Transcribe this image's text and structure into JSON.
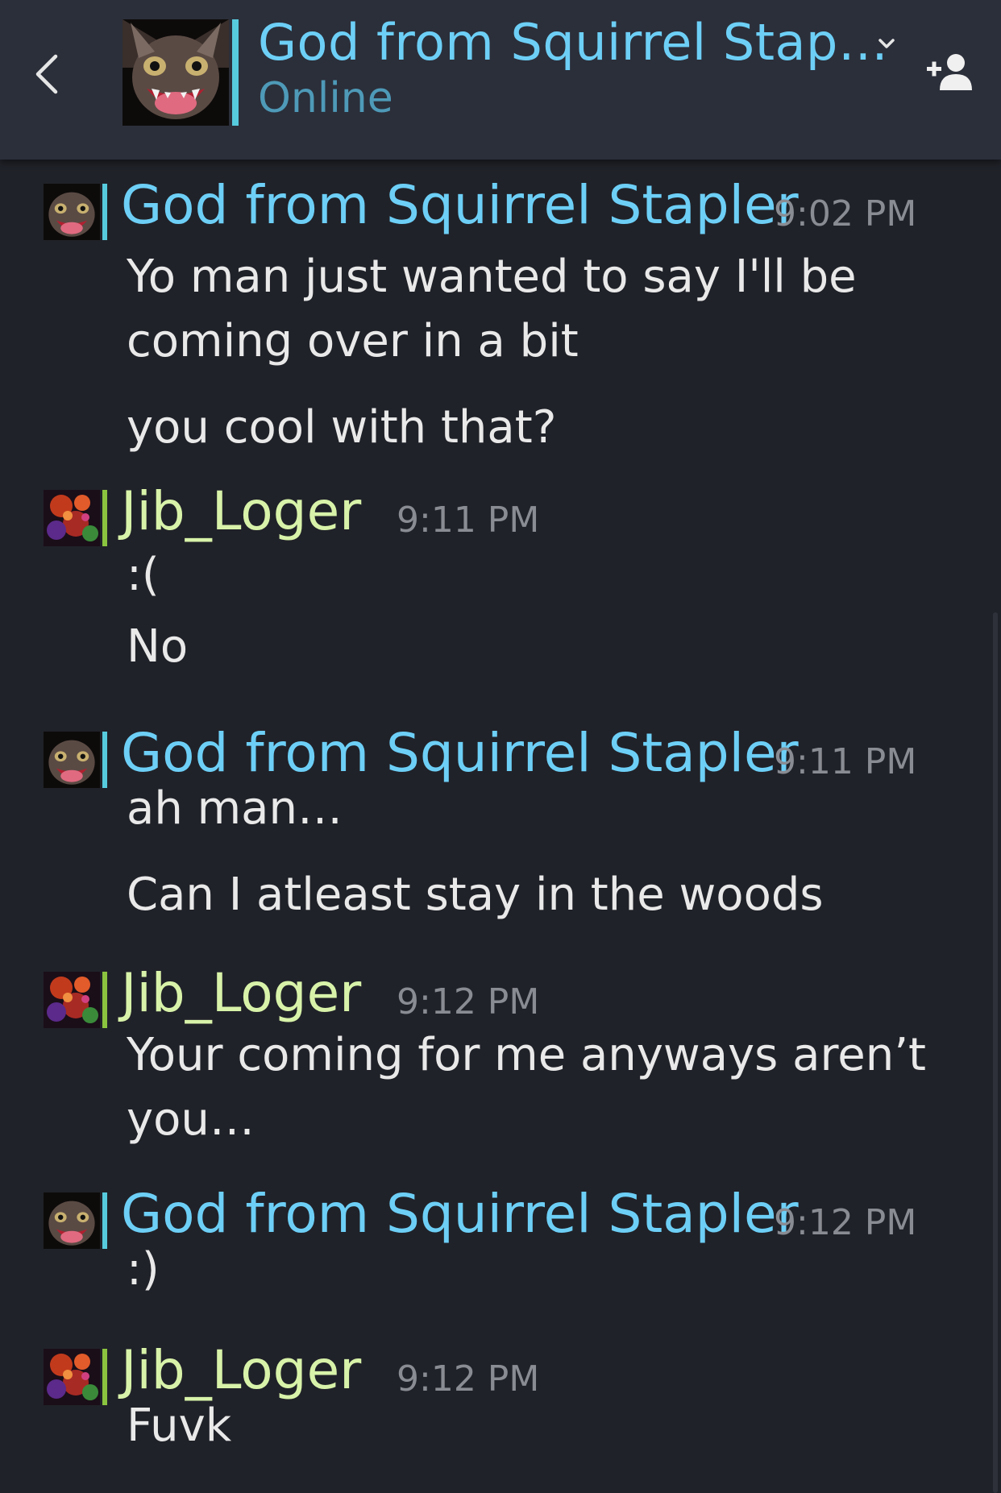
{
  "header": {
    "title": "God from Squirrel Stap…",
    "status": "Online",
    "back_icon": "chevron-left-icon",
    "dropdown_icon": "chevron-down-icon",
    "add_friend_icon": "add-friend-icon"
  },
  "colors": {
    "header_bg": "#2b2f3a",
    "body_bg": "#202229",
    "god_name": "#6dcff6",
    "jib_name": "#d8f3a9",
    "online_bar": "#57cbde",
    "ingame_bar": "#8bc53f",
    "timestamp": "#8a8c93"
  },
  "messages": [
    {
      "author": "God from Squirrel Stapler",
      "time": "9:02 PM",
      "lines": [
        "Yo man just wanted to say I'll be coming over in a bit",
        "you cool with that?"
      ]
    },
    {
      "author": "Jib_Loger",
      "time": "9:11 PM",
      "lines": [
        ":(",
        "No"
      ]
    },
    {
      "author": "God from Squirrel Stapler",
      "time": "9:11 PM",
      "lines": [
        "ah man…",
        "Can I atleast stay in the woods"
      ]
    },
    {
      "author": "Jib_Loger",
      "time": "9:12 PM",
      "lines": [
        "Your coming for me anyways aren’t you…"
      ]
    },
    {
      "author": "God from Squirrel Stapler",
      "time": "9:12 PM",
      "lines": [
        ":)"
      ]
    },
    {
      "author": "Jib_Loger",
      "time": "9:12 PM",
      "lines": [
        "Fuvk"
      ]
    }
  ]
}
